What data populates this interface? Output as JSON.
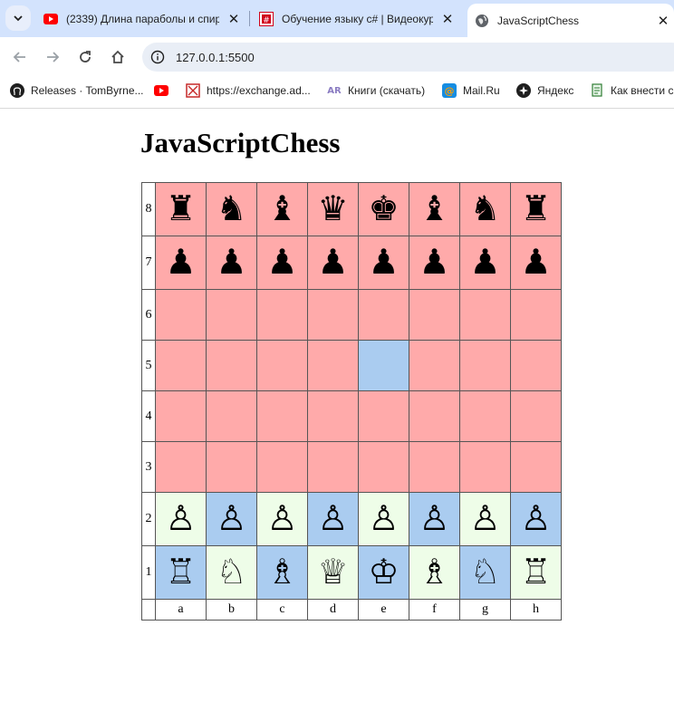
{
  "browser": {
    "tabs": [
      {
        "title": "(2339) Длина параболы и спир",
        "favicon": "youtube-icon",
        "active": false
      },
      {
        "title": "Обучение языку с# | Видеокур",
        "favicon": "course-site-icon",
        "active": false
      },
      {
        "title": "JavaScriptChess",
        "favicon": "globe-icon",
        "active": true
      }
    ],
    "url": "127.0.0.1:5500",
    "bookmarks": [
      {
        "label": "Releases · TomByrne...",
        "icon": "github-icon"
      },
      {
        "label": "",
        "icon": "youtube-icon"
      },
      {
        "label": "https://exchange.ad...",
        "icon": "exchange-icon"
      },
      {
        "label": "Книги (скачать)",
        "icon": "ar-icon"
      },
      {
        "label": "Mail.Ru",
        "icon": "mailru-icon"
      },
      {
        "label": "Яндекс",
        "icon": "yandex-icon"
      },
      {
        "label": "Как внести с",
        "icon": "doc-icon"
      }
    ]
  },
  "page": {
    "heading": "JavaScriptChess",
    "ranks": [
      "8",
      "7",
      "6",
      "5",
      "4",
      "3",
      "2",
      "1"
    ],
    "files": [
      "a",
      "b",
      "c",
      "d",
      "e",
      "f",
      "g",
      "h"
    ],
    "colors": {
      "red": "#ffaaaa",
      "blue": "#aaccf0",
      "light": "#eefde8"
    },
    "board": [
      [
        {
          "p": "♜",
          "c": "red"
        },
        {
          "p": "♞",
          "c": "red"
        },
        {
          "p": "♝",
          "c": "red"
        },
        {
          "p": "♛",
          "c": "red"
        },
        {
          "p": "♚",
          "c": "red"
        },
        {
          "p": "♝",
          "c": "red"
        },
        {
          "p": "♞",
          "c": "red"
        },
        {
          "p": "♜",
          "c": "red"
        }
      ],
      [
        {
          "p": "♟",
          "c": "red"
        },
        {
          "p": "♟",
          "c": "red"
        },
        {
          "p": "♟",
          "c": "red"
        },
        {
          "p": "♟",
          "c": "red"
        },
        {
          "p": "♟",
          "c": "red"
        },
        {
          "p": "♟",
          "c": "red"
        },
        {
          "p": "♟",
          "c": "red"
        },
        {
          "p": "♟",
          "c": "red"
        }
      ],
      [
        {
          "p": "",
          "c": "red"
        },
        {
          "p": "",
          "c": "red"
        },
        {
          "p": "",
          "c": "red"
        },
        {
          "p": "",
          "c": "red"
        },
        {
          "p": "",
          "c": "red"
        },
        {
          "p": "",
          "c": "red"
        },
        {
          "p": "",
          "c": "red"
        },
        {
          "p": "",
          "c": "red"
        }
      ],
      [
        {
          "p": "",
          "c": "red"
        },
        {
          "p": "",
          "c": "red"
        },
        {
          "p": "",
          "c": "red"
        },
        {
          "p": "",
          "c": "red"
        },
        {
          "p": "",
          "c": "blue"
        },
        {
          "p": "",
          "c": "red"
        },
        {
          "p": "",
          "c": "red"
        },
        {
          "p": "",
          "c": "red"
        }
      ],
      [
        {
          "p": "",
          "c": "red"
        },
        {
          "p": "",
          "c": "red"
        },
        {
          "p": "",
          "c": "red"
        },
        {
          "p": "",
          "c": "red"
        },
        {
          "p": "",
          "c": "red"
        },
        {
          "p": "",
          "c": "red"
        },
        {
          "p": "",
          "c": "red"
        },
        {
          "p": "",
          "c": "red"
        }
      ],
      [
        {
          "p": "",
          "c": "red"
        },
        {
          "p": "",
          "c": "red"
        },
        {
          "p": "",
          "c": "red"
        },
        {
          "p": "",
          "c": "red"
        },
        {
          "p": "",
          "c": "red"
        },
        {
          "p": "",
          "c": "red"
        },
        {
          "p": "",
          "c": "red"
        },
        {
          "p": "",
          "c": "red"
        }
      ],
      [
        {
          "p": "♙",
          "c": "light"
        },
        {
          "p": "♙",
          "c": "blue"
        },
        {
          "p": "♙",
          "c": "light"
        },
        {
          "p": "♙",
          "c": "blue"
        },
        {
          "p": "♙",
          "c": "light"
        },
        {
          "p": "♙",
          "c": "blue"
        },
        {
          "p": "♙",
          "c": "light"
        },
        {
          "p": "♙",
          "c": "blue"
        }
      ],
      [
        {
          "p": "♖",
          "c": "blue"
        },
        {
          "p": "♘",
          "c": "light"
        },
        {
          "p": "♗",
          "c": "blue"
        },
        {
          "p": "♕",
          "c": "light"
        },
        {
          "p": "♔",
          "c": "blue"
        },
        {
          "p": "♗",
          "c": "light"
        },
        {
          "p": "♘",
          "c": "blue"
        },
        {
          "p": "♖",
          "c": "light"
        }
      ]
    ]
  }
}
